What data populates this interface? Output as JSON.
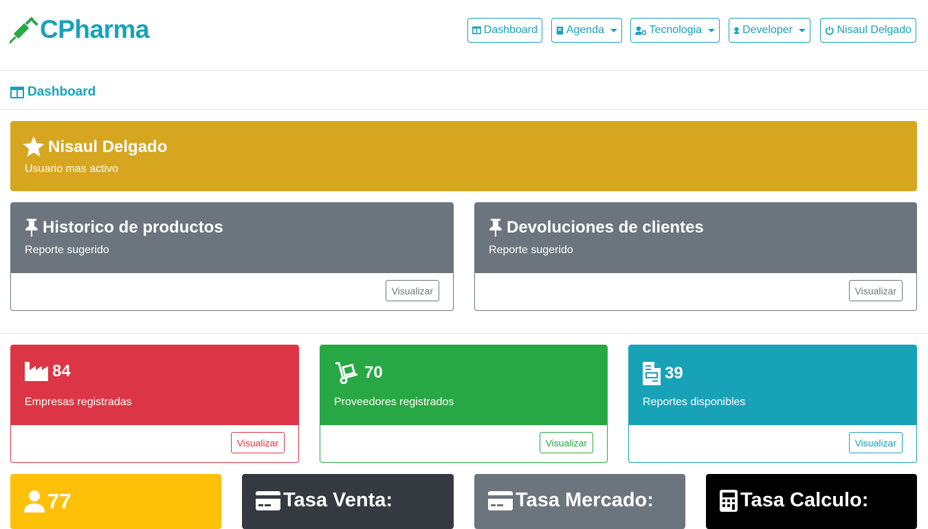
{
  "brand": {
    "name": "CPharma"
  },
  "nav": {
    "dashboard": "Dashboard",
    "agenda": "Agenda",
    "tecnologia": "Tecnologia",
    "developer": "Developer",
    "user": "Nisaul Delgado"
  },
  "breadcrumb": {
    "title": "Dashboard"
  },
  "top_user": {
    "name": "Nisaul Delgado",
    "caption": "Usuario mas activo"
  },
  "suggested": [
    {
      "title": "Historico de productos",
      "caption": "Reporte sugerido",
      "button": "Visualizar"
    },
    {
      "title": "Devoluciones de clientes",
      "caption": "Reporte sugerido",
      "button": "Visualizar"
    }
  ],
  "stats": [
    {
      "value": "84",
      "caption": "Empresas registradas",
      "button": "Visualizar",
      "color": "#dc3545",
      "icon": "industry-icon"
    },
    {
      "value": "70",
      "caption": "Proveedores registrados",
      "button": "Visualizar",
      "color": "#28a745",
      "icon": "dolly-icon"
    },
    {
      "value": "39",
      "caption": "Reportes disponibles",
      "button": "Visualizar",
      "color": "#17a2b8",
      "icon": "file-invoice-icon"
    }
  ],
  "bottom": [
    {
      "value": "77",
      "color": "#ffc107",
      "icon": "user-icon"
    },
    {
      "title": "Tasa Venta:",
      "color": "#343a40",
      "icon": "credit-card-icon"
    },
    {
      "title": "Tasa Mercado:",
      "color": "#6c757d",
      "icon": "credit-card-icon"
    },
    {
      "title": "Tasa Calculo:",
      "color": "#000000",
      "icon": "calculator-icon"
    }
  ],
  "colors": {
    "accent": "#17a2b8",
    "gold": "#d6a621",
    "gray": "#6c757d"
  }
}
